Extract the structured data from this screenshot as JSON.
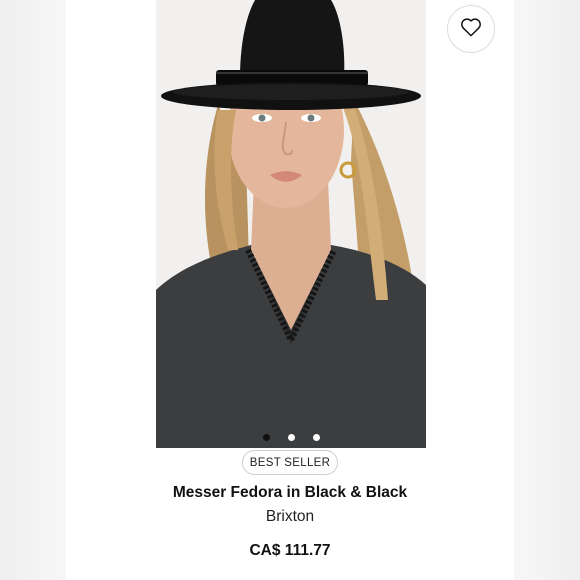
{
  "product": {
    "badge": "BEST SELLER",
    "title": "Messer Fedora in Black & Black",
    "brand": "Brixton",
    "price": "CA$ 111.77"
  },
  "gallery": {
    "image_count": 3,
    "active_index": 0
  },
  "icons": {
    "wishlist": "heart-outline-icon"
  },
  "colors": {
    "hat": "#151515",
    "sweater": "#3a3c3e",
    "background": "#ffffff"
  }
}
